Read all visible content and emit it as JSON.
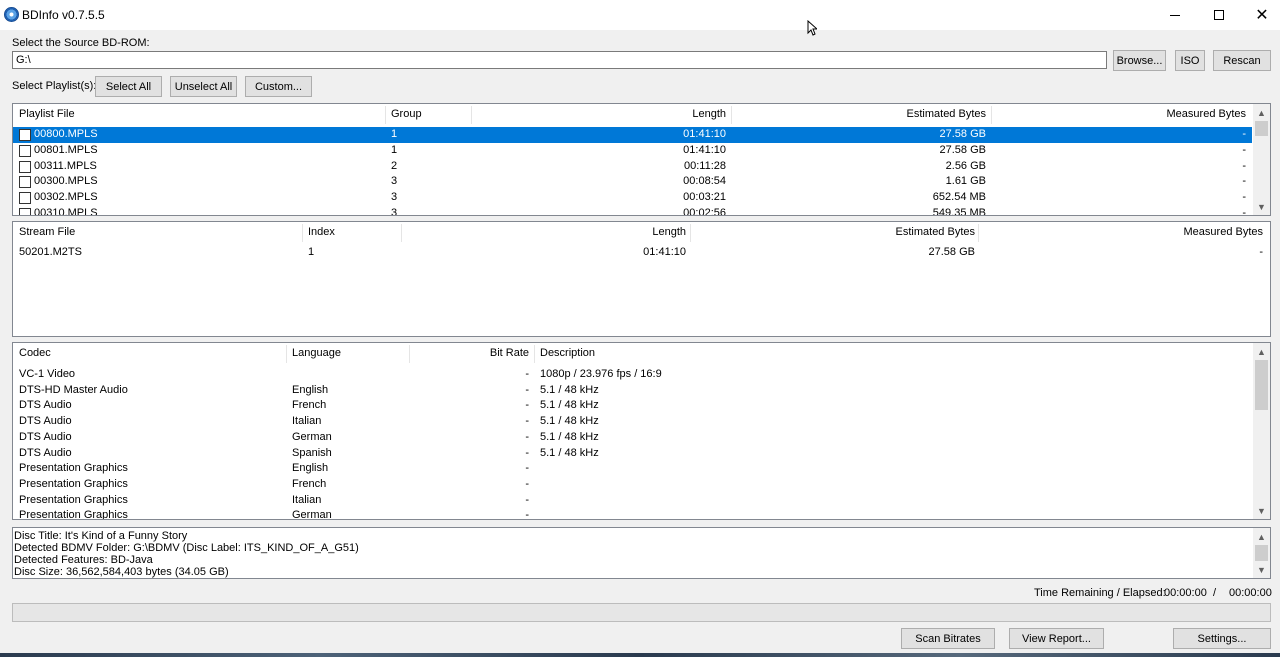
{
  "window": {
    "title": "BDInfo v0.7.5.5",
    "minimize_icon": "minimize-icon",
    "maximize_icon": "maximize-icon",
    "close_icon": "close-icon",
    "close_glyph": "✕"
  },
  "source": {
    "label": "Select the Source BD-ROM:",
    "path_value": "G:\\",
    "browse_label": "Browse...",
    "iso_label": "ISO",
    "rescan_label": "Rescan"
  },
  "playlist_select": {
    "label": "Select Playlist(s):",
    "select_all_label": "Select All",
    "unselect_all_label": "Unselect All",
    "custom_label": "Custom..."
  },
  "playlists": {
    "columns": [
      "Playlist File",
      "Group",
      "Length",
      "Estimated Bytes",
      "Measured Bytes"
    ],
    "rows": [
      {
        "file": "00800.MPLS",
        "group": "1",
        "length": "01:41:10",
        "estimated": "27.58 GB",
        "measured": "-",
        "selected": true
      },
      {
        "file": "00801.MPLS",
        "group": "1",
        "length": "01:41:10",
        "estimated": "27.58 GB",
        "measured": "-",
        "selected": false
      },
      {
        "file": "00311.MPLS",
        "group": "2",
        "length": "00:11:28",
        "estimated": "2.56 GB",
        "measured": "-",
        "selected": false
      },
      {
        "file": "00300.MPLS",
        "group": "3",
        "length": "00:08:54",
        "estimated": "1.61 GB",
        "measured": "-",
        "selected": false
      },
      {
        "file": "00302.MPLS",
        "group": "3",
        "length": "00:03:21",
        "estimated": "652.54 MB",
        "measured": "-",
        "selected": false
      },
      {
        "file": "00310.MPLS",
        "group": "3",
        "length": "00:02:56",
        "estimated": "549.35 MB",
        "measured": "-",
        "selected": false
      }
    ]
  },
  "streams": {
    "columns": [
      "Stream File",
      "Index",
      "Length",
      "Estimated Bytes",
      "Measured Bytes"
    ],
    "rows": [
      {
        "file": "50201.M2TS",
        "index": "1",
        "length": "01:41:10",
        "estimated": "27.58 GB",
        "measured": "-"
      }
    ]
  },
  "codecs": {
    "columns": [
      "Codec",
      "Language",
      "Bit Rate",
      "Description"
    ],
    "rows": [
      {
        "codec": "VC-1 Video",
        "language": "",
        "bitrate": "-",
        "description": "1080p / 23.976 fps / 16:9"
      },
      {
        "codec": "DTS-HD Master Audio",
        "language": "English",
        "bitrate": "-",
        "description": "5.1 / 48 kHz"
      },
      {
        "codec": "DTS Audio",
        "language": "French",
        "bitrate": "-",
        "description": "5.1 / 48 kHz"
      },
      {
        "codec": "DTS Audio",
        "language": "Italian",
        "bitrate": "-",
        "description": "5.1 / 48 kHz"
      },
      {
        "codec": "DTS Audio",
        "language": "German",
        "bitrate": "-",
        "description": "5.1 / 48 kHz"
      },
      {
        "codec": "DTS Audio",
        "language": "Spanish",
        "bitrate": "-",
        "description": "5.1 / 48 kHz"
      },
      {
        "codec": "Presentation Graphics",
        "language": "English",
        "bitrate": "-",
        "description": ""
      },
      {
        "codec": "Presentation Graphics",
        "language": "French",
        "bitrate": "-",
        "description": ""
      },
      {
        "codec": "Presentation Graphics",
        "language": "Italian",
        "bitrate": "-",
        "description": ""
      },
      {
        "codec": "Presentation Graphics",
        "language": "German",
        "bitrate": "-",
        "description": ""
      }
    ]
  },
  "disc_info": {
    "lines": [
      "Disc Title: It's Kind of a Funny Story",
      "Detected BDMV Folder: G:\\BDMV (Disc Label: ITS_KIND_OF_A_G51)",
      "Detected Features: BD-Java",
      "Disc Size: 36,562,584,403 bytes (34.05 GB)"
    ]
  },
  "status": {
    "time_label": "Time Remaining / Elapsed:",
    "remaining": "00:00:00",
    "separator": "/",
    "elapsed": "00:00:00",
    "progress": 0
  },
  "actions": {
    "scan_label": "Scan Bitrates",
    "report_label": "View Report...",
    "settings_label": "Settings..."
  }
}
